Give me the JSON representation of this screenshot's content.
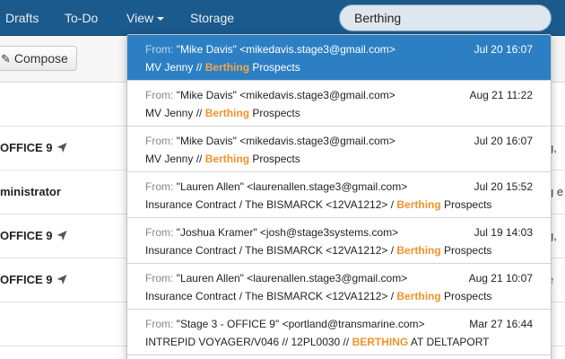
{
  "nav": {
    "items": [
      {
        "label": "Drafts"
      },
      {
        "label": "To-Do"
      },
      {
        "label": "View"
      },
      {
        "label": "Storage"
      }
    ],
    "search_value": "Berthing"
  },
  "toolbar": {
    "compose_label": "Compose"
  },
  "background_rows": [
    {
      "left": "",
      "right": ""
    },
    {
      "left": "OFFICE 9",
      "right": "g,"
    },
    {
      "left": "ministrator",
      "right": "g e"
    },
    {
      "left": "OFFICE 9",
      "right": "g,"
    },
    {
      "left": "OFFICE 9",
      "right": "e"
    },
    {
      "left": "",
      "right": ""
    }
  ],
  "results": [
    {
      "from_label": "From:",
      "from": "\"Mike Davis\" <mikedavis.stage3@gmail.com>",
      "date": "Jul 20 16:07",
      "subject_pre": "MV Jenny // ",
      "subject_hl": "Berthing",
      "subject_post": " Prospects",
      "active": true
    },
    {
      "from_label": "From:",
      "from": "\"Mike Davis\" <mikedavis.stage3@gmail.com>",
      "date": "Aug 21 11:22",
      "subject_pre": "MV Jenny // ",
      "subject_hl": "Berthing",
      "subject_post": " Prospects"
    },
    {
      "from_label": "From:",
      "from": "\"Mike Davis\" <mikedavis.stage3@gmail.com>",
      "date": "Jul 20 16:07",
      "subject_pre": "MV Jenny // ",
      "subject_hl": "Berthing",
      "subject_post": " Prospects"
    },
    {
      "from_label": "From:",
      "from": "\"Lauren Allen\" <laurenallen.stage3@gmail.com>",
      "date": "Jul 20 15:52",
      "subject_pre": "Insurance Contract / The BISMARCK <12VA1212> / ",
      "subject_hl": "Berthing",
      "subject_post": " Prospects"
    },
    {
      "from_label": "From:",
      "from": "\"Joshua Kramer\" <josh@stage3systems.com>",
      "date": "Jul 19 14:03",
      "subject_pre": "Insurance Contract / The BISMARCK <12VA1212> / ",
      "subject_hl": "Berthing",
      "subject_post": " Prospects"
    },
    {
      "from_label": "From:",
      "from": "\"Lauren Allen\" <laurenallen.stage3@gmail.com>",
      "date": "Aug 21 10:07",
      "subject_pre": "Insurance Contract / The BISMARCK <12VA1212> / ",
      "subject_hl": "Berthing",
      "subject_post": " Prospects"
    },
    {
      "from_label": "From:",
      "from": "\"Stage 3 - OFFICE 9\" <portland@transmarine.com>",
      "date": "Mar 27 16:44",
      "subject_pre": "INTREPID VOYAGER/V046 // 12PL0030 // ",
      "subject_hl": "BERTHING",
      "subject_post": " AT DELTAPORT"
    }
  ]
}
